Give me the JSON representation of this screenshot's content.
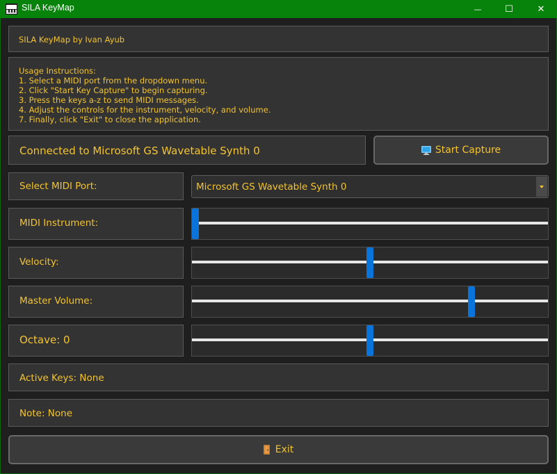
{
  "window": {
    "title": "SILA KeyMap",
    "icon": "app-icon",
    "minimize_glyph": "—",
    "maximize_glyph": "☐",
    "close_glyph": "✕"
  },
  "header": {
    "title": "SILA KeyMap by Ivan Ayub"
  },
  "instructions": {
    "heading": "Usage Instructions:",
    "lines": [
      "1. Select a MIDI port from the dropdown menu.",
      "2. Click \"Start Key Capture\" to begin capturing.",
      "3. Press the keys a-z to send MIDI messages.",
      "4. Adjust the controls for the instrument, velocity, and volume.",
      "7. Finally, click \"Exit\" to close the application."
    ]
  },
  "status": {
    "text": "Connected to Microsoft GS Wavetable Synth 0"
  },
  "capture_button": {
    "label": "Start Capture",
    "icon": "monitor-icon"
  },
  "midi_port": {
    "label": "Select MIDI Port:",
    "selected": "Microsoft GS Wavetable Synth 0"
  },
  "instrument": {
    "label": "MIDI Instrument:",
    "level": 0.0
  },
  "velocity": {
    "label": "Velocity:",
    "level": 0.5
  },
  "volume": {
    "label": "Master Volume:",
    "level": 0.79
  },
  "octave": {
    "label": "Octave: 0",
    "level": 0.5
  },
  "active_keys": {
    "text": "Active Keys: None"
  },
  "note": {
    "text": "Note: None"
  },
  "exit_button": {
    "label": "Exit",
    "icon": "door-icon"
  },
  "colors": {
    "titlebar": "#07820a",
    "accent_text": "#f4c430",
    "slider_handle": "#0a74da",
    "panel_bg": "#333333"
  }
}
